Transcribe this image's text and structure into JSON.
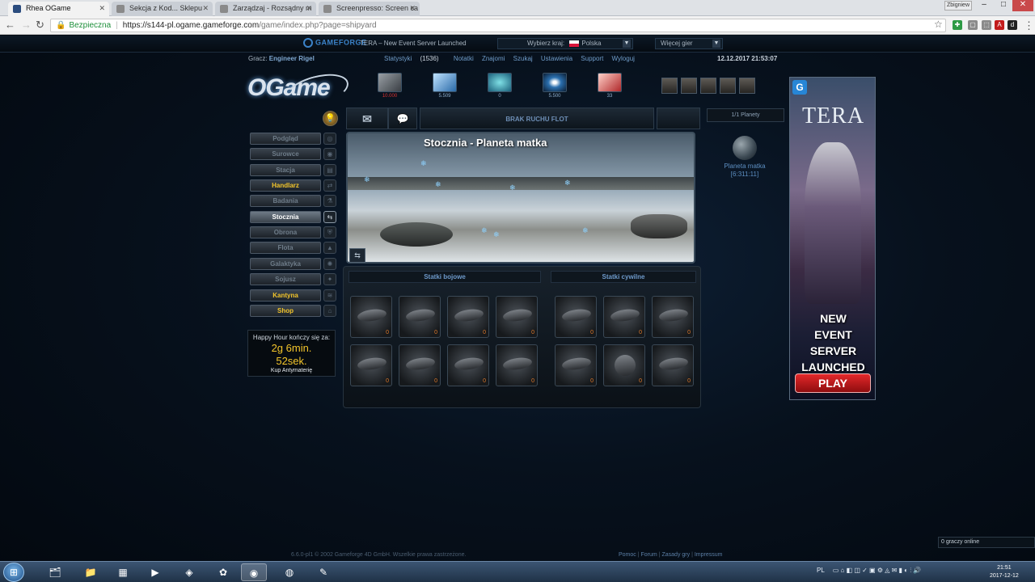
{
  "browser": {
    "tabs": [
      {
        "label": "Rhea OGame",
        "active": true
      },
      {
        "label": "Sekcja z Kod... Sklepu",
        "active": false
      },
      {
        "label": "Zarządzaj - Rozsądny m",
        "active": false
      },
      {
        "label": "Screenpresso: Screen ca",
        "active": false
      }
    ],
    "profile": "Zbigniew",
    "secure_label": "Bezpieczna",
    "url_host": "https://s144-pl.ogame.gameforge.com",
    "url_path": "/game/index.php?page=shipyard"
  },
  "gameforge": {
    "logo": "GAMEFORGE",
    "news": "TERA – New Event Server Launched",
    "country_label": "Wybierz kraj:",
    "country": "Polska",
    "more_games": "Więcej gier"
  },
  "topmenu": {
    "player_label": "Gracz:",
    "player_name": "Engineer Rigel",
    "stats_label": "Statystyki",
    "stats_value": "(1536)",
    "links": [
      "Notatki",
      "Znajomi",
      "Szukaj",
      "Ustawienia",
      "Support",
      "Wyloguj"
    ],
    "datetime": "12.12.2017 21:53:07"
  },
  "logo": "OGame",
  "resources": [
    {
      "name": "metal",
      "value": "10.000",
      "color": "#d33333"
    },
    {
      "name": "crystal",
      "value": "5.509",
      "color": "#8fb0cf"
    },
    {
      "name": "deuterium",
      "value": "0",
      "color": "#8fb0cf"
    },
    {
      "name": "energy",
      "value": "5.500",
      "color": "#8fb0cf"
    },
    {
      "name": "antimatter",
      "value": "33",
      "color": "#8fb0cf"
    }
  ],
  "menu": [
    {
      "label": "Podgląd",
      "style": "normal"
    },
    {
      "label": "Surowce",
      "style": "normal"
    },
    {
      "label": "Stacja",
      "style": "normal"
    },
    {
      "label": "Handlarz",
      "style": "gold"
    },
    {
      "label": "Badania",
      "style": "normal"
    },
    {
      "label": "Stocznia",
      "style": "active"
    },
    {
      "label": "Obrona",
      "style": "normal"
    },
    {
      "label": "Flota",
      "style": "normal"
    },
    {
      "label": "Galaktyka",
      "style": "normal"
    },
    {
      "label": "Sojusz",
      "style": "normal"
    },
    {
      "label": "Kantyna",
      "style": "gold"
    },
    {
      "label": "Shop",
      "style": "gold"
    }
  ],
  "happy_hour": {
    "label": "Happy Hour kończy się za:",
    "time_line1": "2g 6min.",
    "time_line2": "52sek.",
    "buy": "Kup Antymaterię"
  },
  "fleet_bar": {
    "text": "BRAK RUCHU FLOT"
  },
  "planets": {
    "count": "1/1 Planety",
    "name": "Planeta matka",
    "coords": "[6:311:11]"
  },
  "banner": {
    "title": "Stocznia - Planeta matka"
  },
  "shipyard": {
    "combat_label": "Statki bojowe",
    "civil_label": "Statki cywilne",
    "combat_ships": [
      "0",
      "0",
      "0",
      "0",
      "0",
      "0",
      "0",
      "0"
    ],
    "civil_ships": [
      "0",
      "0",
      "0",
      "0",
      "0",
      "0"
    ]
  },
  "ad": {
    "brand": "TERA",
    "line1": "NEW",
    "line2": "EVENT SERVER",
    "line3": "LAUNCHED",
    "cta": "PLAY"
  },
  "footer": {
    "copyright": "6.6.0-pl1  ©  2002 Gameforge 4D GmbH. Wszelkie prawa zastrzeżone.",
    "links": [
      "Pomoc",
      "Forum",
      "Zasady gry",
      "Impressum"
    ],
    "online": "0 graczy online"
  },
  "taskbar": {
    "lang": "PL",
    "time": "21:51",
    "date": "2017-12-12"
  }
}
